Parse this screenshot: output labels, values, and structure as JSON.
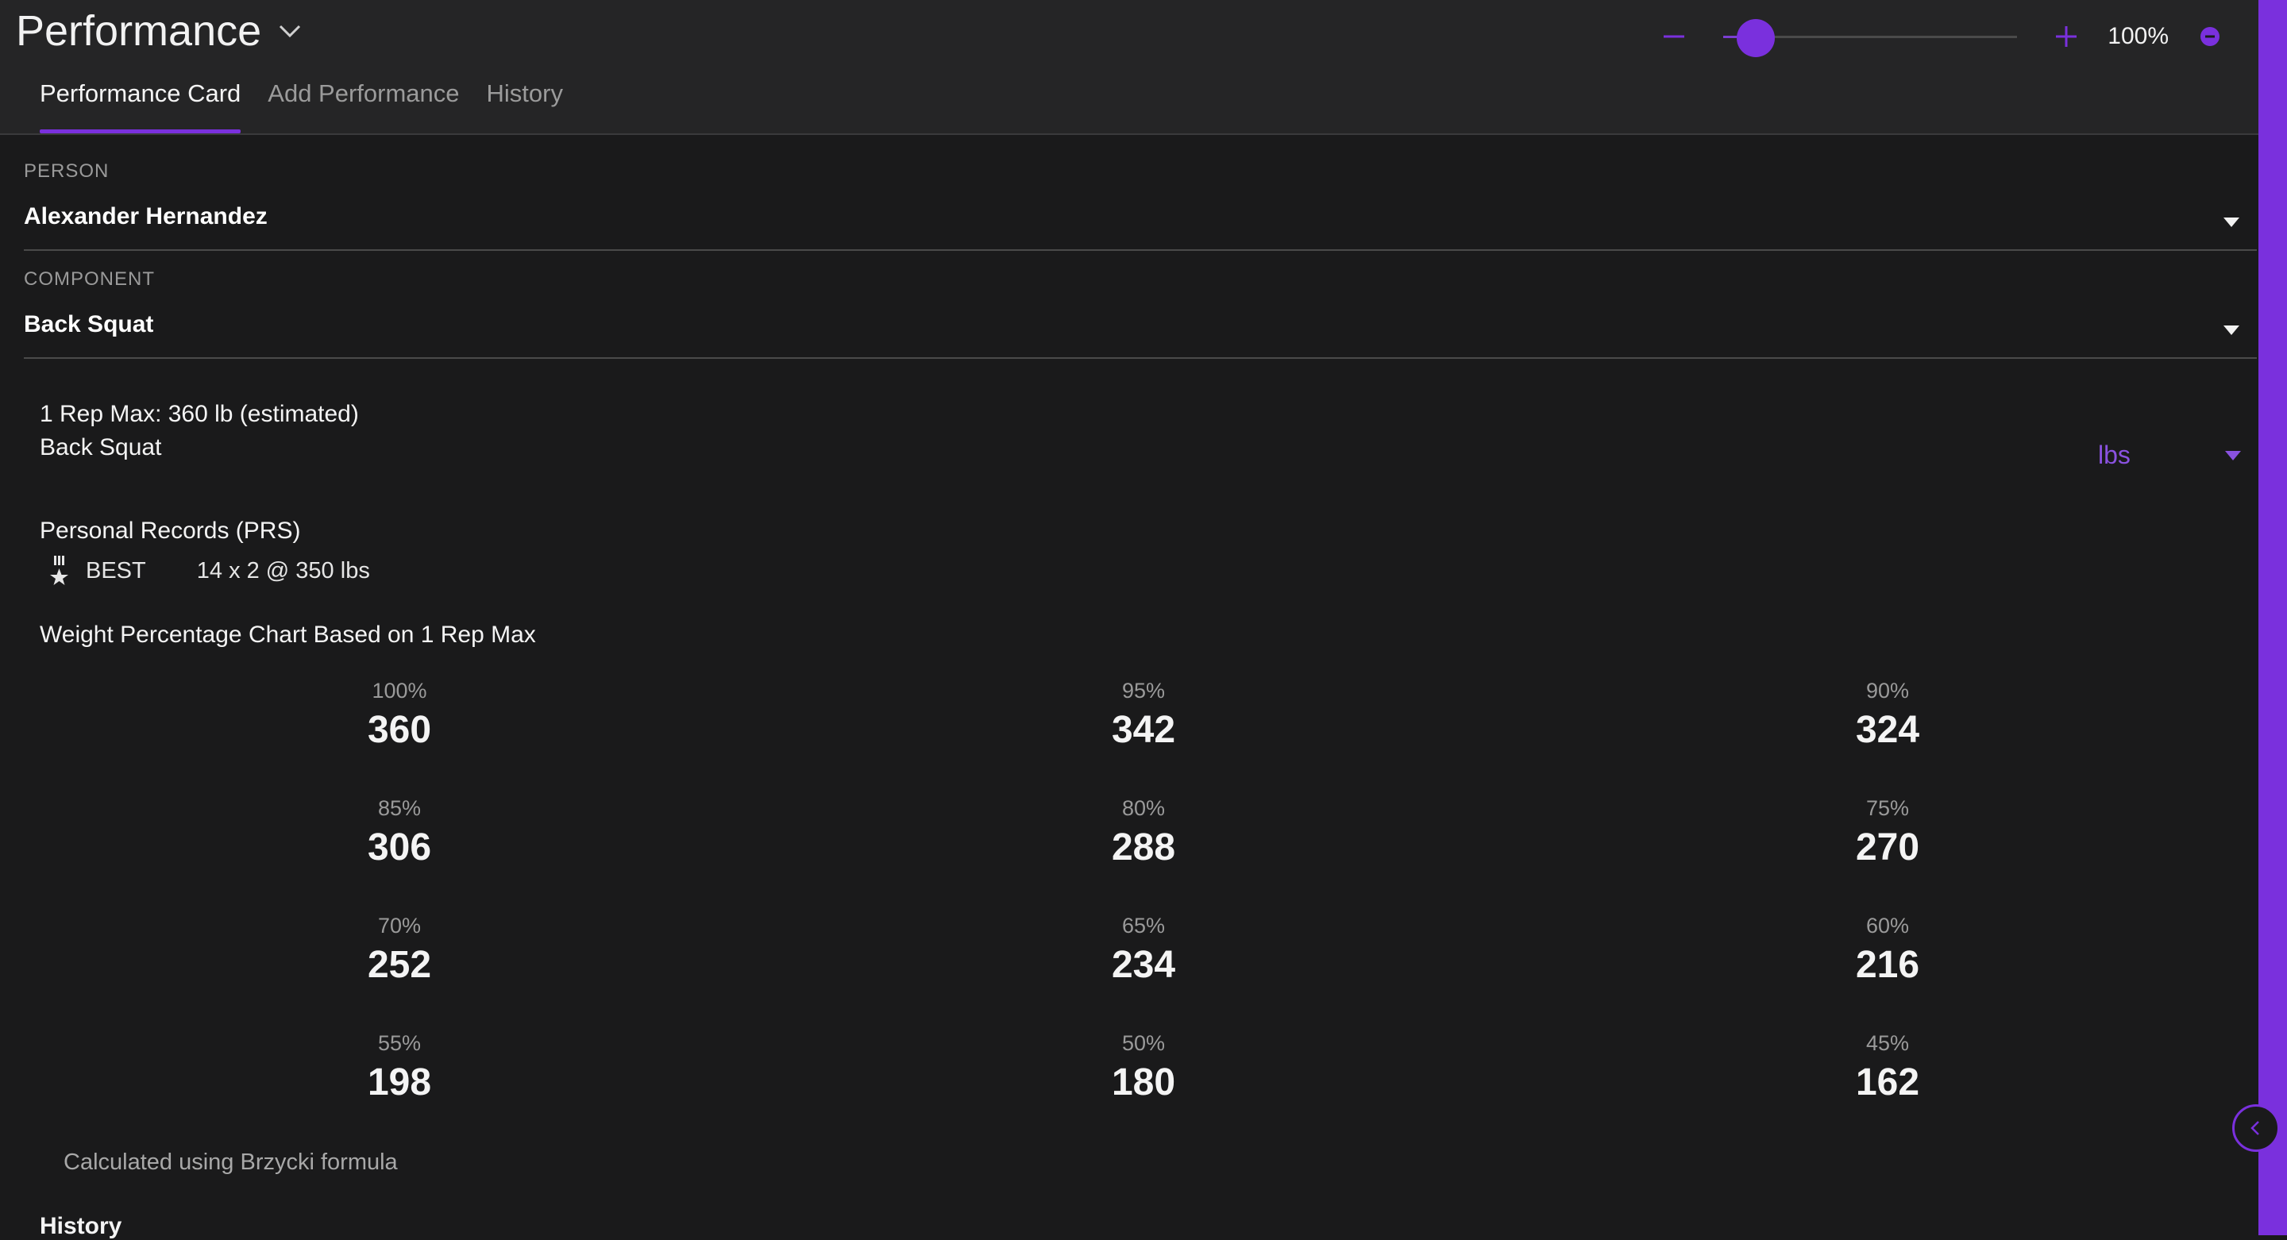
{
  "app": {
    "title": "Performance"
  },
  "zoom": {
    "percent_label": "100%",
    "level": 0.11
  },
  "tabs": [
    {
      "label": "Performance Card",
      "active": true
    },
    {
      "label": "Add Performance",
      "active": false
    },
    {
      "label": "History",
      "active": false
    }
  ],
  "person": {
    "label": "PERSON",
    "value": "Alexander Hernandez"
  },
  "component": {
    "label": "COMPONENT",
    "value": "Back Squat"
  },
  "one_rep_max": {
    "title": "1 Rep Max: 360 lb (estimated)",
    "subtitle": "Back Squat"
  },
  "unit_select": {
    "value": "lbs"
  },
  "personal_records": {
    "title": "Personal Records (PRS)",
    "items": [
      {
        "badge": "BEST",
        "value": "14 x 2 @ 350 lbs"
      }
    ]
  },
  "percentage_chart": {
    "title": "Weight Percentage Chart Based on 1 Rep Max",
    "rows": [
      [
        {
          "pct": "100%",
          "weight": "360"
        },
        {
          "pct": "95%",
          "weight": "342"
        },
        {
          "pct": "90%",
          "weight": "324"
        }
      ],
      [
        {
          "pct": "85%",
          "weight": "306"
        },
        {
          "pct": "80%",
          "weight": "288"
        },
        {
          "pct": "75%",
          "weight": "270"
        }
      ],
      [
        {
          "pct": "70%",
          "weight": "252"
        },
        {
          "pct": "65%",
          "weight": "234"
        },
        {
          "pct": "60%",
          "weight": "216"
        }
      ],
      [
        {
          "pct": "55%",
          "weight": "198"
        },
        {
          "pct": "50%",
          "weight": "180"
        },
        {
          "pct": "45%",
          "weight": "162"
        }
      ]
    ],
    "note": "Calculated using Brzycki formula"
  },
  "history": {
    "title": "History"
  },
  "colors": {
    "accent": "#7a30dd",
    "background": "#1a1a1b",
    "topbar": "#252526"
  },
  "icons": {
    "title_chevron": "chevron-down-icon",
    "zoom_out": "minus-icon",
    "zoom_in": "plus-icon",
    "zoom_reset": "minus-circle-icon",
    "pr_badge": "medal-icon",
    "collapse": "chevron-left-icon"
  }
}
